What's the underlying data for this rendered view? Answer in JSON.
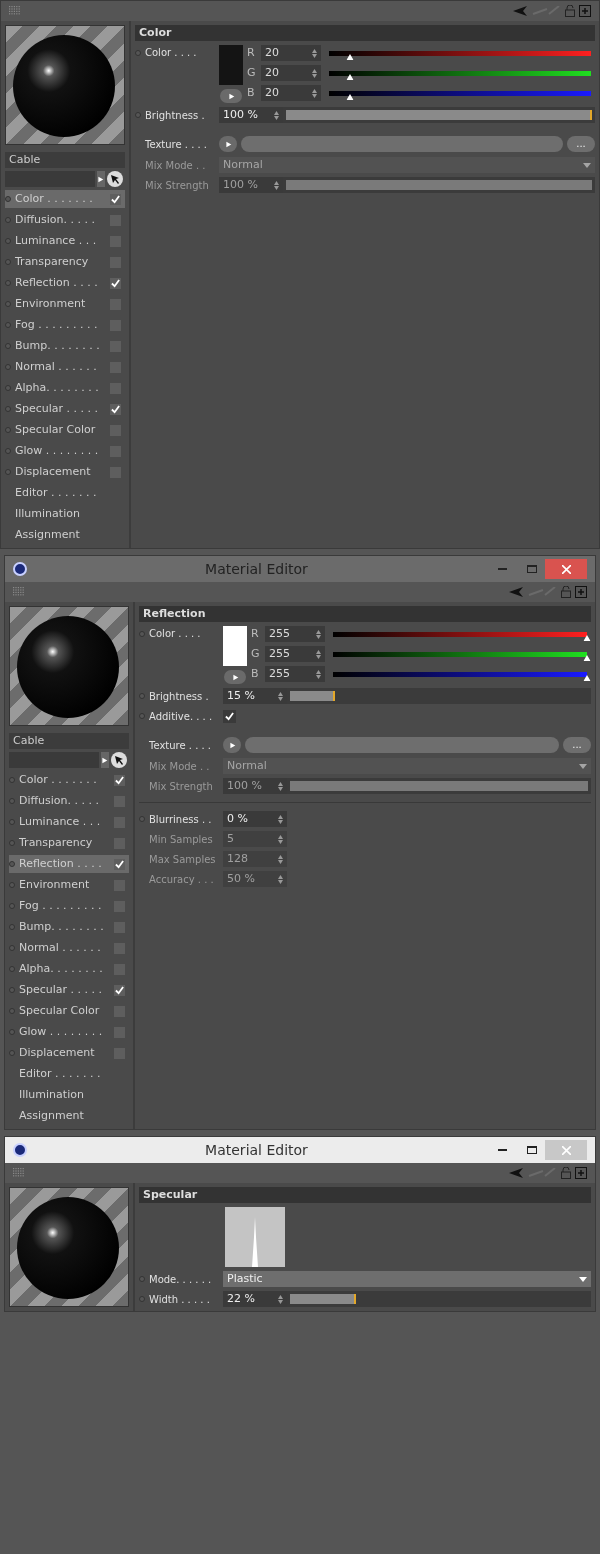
{
  "panels": [
    {
      "material_name": "Cable",
      "section": "Color",
      "channels": [
        {
          "kind": "channel",
          "label": "Color . . . . . . .",
          "checked": true,
          "selected": true
        },
        {
          "kind": "channel",
          "label": "Diffusion. . . . .",
          "checked": false,
          "selected": false
        },
        {
          "kind": "channel",
          "label": "Luminance . . .",
          "checked": false,
          "selected": false
        },
        {
          "kind": "channel",
          "label": "Transparency",
          "checked": false,
          "selected": false
        },
        {
          "kind": "channel",
          "label": "Reflection . . . .",
          "checked": true,
          "selected": false
        },
        {
          "kind": "channel",
          "label": "Environment",
          "checked": false,
          "selected": false
        },
        {
          "kind": "channel",
          "label": "Fog . . . . . . . . .",
          "checked": false,
          "selected": false
        },
        {
          "kind": "channel",
          "label": "Bump. . . . . . . .",
          "checked": false,
          "selected": false
        },
        {
          "kind": "channel",
          "label": "Normal . . . . . .",
          "checked": false,
          "selected": false
        },
        {
          "kind": "channel",
          "label": "Alpha. . . . . . . .",
          "checked": false,
          "selected": false
        },
        {
          "kind": "channel",
          "label": "Specular . . . . .",
          "checked": true,
          "selected": false
        },
        {
          "kind": "channel",
          "label": "Specular Color",
          "checked": false,
          "selected": false
        },
        {
          "kind": "channel",
          "label": "Glow . . . . . . . .",
          "checked": false,
          "selected": false
        },
        {
          "kind": "channel",
          "label": "Displacement",
          "checked": false,
          "selected": false
        },
        {
          "kind": "page",
          "label": "Editor . . . . . . .",
          "selected": false
        },
        {
          "kind": "page",
          "label": "Illumination",
          "selected": false
        },
        {
          "kind": "page",
          "label": "Assignment",
          "selected": false
        }
      ],
      "params": [
        {
          "kind": "color",
          "label": "Color . . . .",
          "color": "#141414",
          "rows": [
            {
              "letter": "R",
              "value": "20",
              "level": 0.08
            },
            {
              "letter": "G",
              "value": "20",
              "level": 0.08
            },
            {
              "letter": "B",
              "value": "20",
              "level": 0.08
            }
          ]
        },
        {
          "kind": "slider",
          "label": "Brightness .",
          "value": "100 %",
          "level": 1,
          "disabled": false
        },
        {
          "kind": "texture",
          "label": "Texture . . . .",
          "button": "..."
        },
        {
          "kind": "dropdown",
          "label": "Mix Mode . .",
          "value": "Normal",
          "disabled": true
        },
        {
          "kind": "slider",
          "label": "Mix Strength",
          "value": "100 %",
          "level": 1,
          "disabled": true
        }
      ]
    },
    {
      "window": {
        "title": "Material Editor",
        "active": true
      },
      "material_name": "Cable",
      "section": "Reflection",
      "channels": [
        {
          "kind": "channel",
          "label": "Color . . . . . . .",
          "checked": true,
          "selected": false
        },
        {
          "kind": "channel",
          "label": "Diffusion. . . . .",
          "checked": false,
          "selected": false
        },
        {
          "kind": "channel",
          "label": "Luminance . . .",
          "checked": false,
          "selected": false
        },
        {
          "kind": "channel",
          "label": "Transparency",
          "checked": false,
          "selected": false
        },
        {
          "kind": "channel",
          "label": "Reflection . . . .",
          "checked": true,
          "selected": true
        },
        {
          "kind": "channel",
          "label": "Environment",
          "checked": false,
          "selected": false
        },
        {
          "kind": "channel",
          "label": "Fog . . . . . . . . .",
          "checked": false,
          "selected": false
        },
        {
          "kind": "channel",
          "label": "Bump. . . . . . . .",
          "checked": false,
          "selected": false
        },
        {
          "kind": "channel",
          "label": "Normal . . . . . .",
          "checked": false,
          "selected": false
        },
        {
          "kind": "channel",
          "label": "Alpha. . . . . . . .",
          "checked": false,
          "selected": false
        },
        {
          "kind": "channel",
          "label": "Specular . . . . .",
          "checked": true,
          "selected": false
        },
        {
          "kind": "channel",
          "label": "Specular Color",
          "checked": false,
          "selected": false
        },
        {
          "kind": "channel",
          "label": "Glow . . . . . . . .",
          "checked": false,
          "selected": false
        },
        {
          "kind": "channel",
          "label": "Displacement",
          "checked": false,
          "selected": false
        },
        {
          "kind": "page",
          "label": "Editor . . . . . . .",
          "selected": false
        },
        {
          "kind": "page",
          "label": "Illumination",
          "selected": false
        },
        {
          "kind": "page",
          "label": "Assignment",
          "selected": false
        }
      ],
      "params": [
        {
          "kind": "color",
          "label": "Color . . . .",
          "color": "#ffffff",
          "rows": [
            {
              "letter": "R",
              "value": "255",
              "level": 1
            },
            {
              "letter": "G",
              "value": "255",
              "level": 1
            },
            {
              "letter": "B",
              "value": "255",
              "level": 1
            }
          ]
        },
        {
          "kind": "slider",
          "label": "Brightness .",
          "value": "15 %",
          "level": 0.15,
          "disabled": false
        },
        {
          "kind": "checkbox",
          "label": "Additive. . . .",
          "checked": true
        },
        {
          "kind": "texture",
          "label": "Texture . . . .",
          "button": "..."
        },
        {
          "kind": "dropdown",
          "label": "Mix Mode . .",
          "value": "Normal",
          "disabled": true
        },
        {
          "kind": "slider",
          "label": "Mix Strength",
          "value": "100 %",
          "level": 1,
          "disabled": true
        },
        {
          "kind": "separator"
        },
        {
          "kind": "number",
          "label": "Blurriness . .",
          "value": "0 %",
          "disabled": false
        },
        {
          "kind": "number",
          "label": "Min Samples",
          "value": "5",
          "disabled": true
        },
        {
          "kind": "number",
          "label": "Max Samples",
          "value": "128",
          "disabled": true
        },
        {
          "kind": "number",
          "label": "Accuracy . . .",
          "value": "50 %",
          "disabled": true
        }
      ]
    },
    {
      "window": {
        "title": "Material Editor",
        "active": false
      },
      "section": "Specular",
      "params": [
        {
          "kind": "curve"
        },
        {
          "kind": "dropdown",
          "label": "Mode. . . . . .",
          "value": "Plastic",
          "disabled": false
        },
        {
          "kind": "slider",
          "label": "Width . . . . .",
          "value": "22 %",
          "level": 0.22,
          "disabled": false
        }
      ]
    }
  ]
}
